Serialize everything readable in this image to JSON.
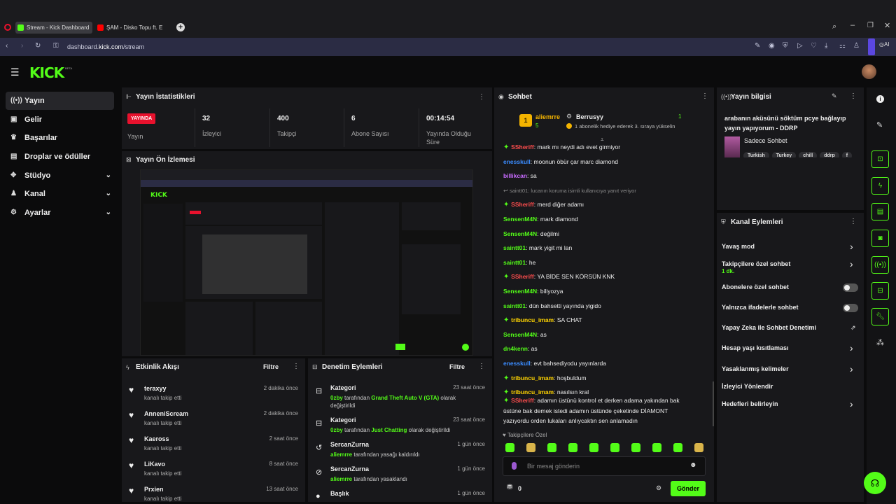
{
  "browser": {
    "tabs": [
      {
        "label": "Stream - Kick Dashboard"
      },
      {
        "label": "ŞAM - Disko Topu ft. E"
      }
    ],
    "url_prefix": "dashboard.",
    "url_host": "kick.com",
    "url_path": "/stream",
    "ai_label": "AI"
  },
  "app": {
    "logo": "KICK",
    "beta": "BETA"
  },
  "sidebar": {
    "items": [
      {
        "label": "Yayın"
      },
      {
        "label": "Gelir"
      },
      {
        "label": "Başarılar"
      },
      {
        "label": "Droplar ve ödüller"
      },
      {
        "label": "Stüdyo"
      },
      {
        "label": "Kanal"
      },
      {
        "label": "Ayarlar"
      }
    ]
  },
  "stats": {
    "title": "Yayın İstatistikleri",
    "live_badge": "YAYINDA",
    "items": [
      {
        "value": "",
        "label": "Yayın"
      },
      {
        "value": "32",
        "label": "İzleyici"
      },
      {
        "value": "400",
        "label": "Takipçi"
      },
      {
        "value": "6",
        "label": "Abone Sayısı"
      },
      {
        "value": "00:14:54",
        "label": "Yayında Olduğu Süre"
      }
    ]
  },
  "preview": {
    "title": "Yayın Ön İzlemesi"
  },
  "activity": {
    "title": "Etkinlik Akışı",
    "filter": "Filtre",
    "items": [
      {
        "name": "teraxyy",
        "sub": "kanalı takip etti",
        "time": "2 dakika önce"
      },
      {
        "name": "AnneniScream",
        "sub": "kanalı takip etti",
        "time": "2 dakika önce"
      },
      {
        "name": "Kaeross",
        "sub": "kanalı takip etti",
        "time": "2 saat önce"
      },
      {
        "name": "LiKavo",
        "sub": "kanalı takip etti",
        "time": "8 saat önce"
      },
      {
        "name": "Prxien",
        "sub": "kanalı takip etti",
        "time": "13 saat önce"
      }
    ]
  },
  "moderation": {
    "title": "Denetim Eylemleri",
    "filter": "Filtre",
    "items": [
      {
        "title": "Kategori",
        "time": "23 saat önce",
        "actor": "0zby",
        "mid": " tarafından ",
        "target": "Grand Theft Auto V (GTA)",
        "rest": " olarak değiştirildi"
      },
      {
        "title": "Kategori",
        "time": "23 saat önce",
        "actor": "0zby",
        "mid": " tarafından ",
        "target": "Just Chatting",
        "rest": " olarak değiştirildi"
      },
      {
        "title": "SercanZurna",
        "time": "1 gün önce",
        "actor": "aliemrre",
        "mid": " tarafından yasağı kaldırıldı",
        "target": "",
        "rest": ""
      },
      {
        "title": "SercanZurna",
        "time": "1 gün önce",
        "actor": "aliemrre",
        "mid": " tarafından yasaklandı",
        "target": "",
        "rest": ""
      },
      {
        "title": "Başlık",
        "time": "1 gün önce",
        "actor": "",
        "mid": "",
        "target": "",
        "rest": ""
      }
    ]
  },
  "chat": {
    "title": "Sohbet",
    "top_gifter": "aliemrre",
    "top_gifter_count": "5",
    "gift_user": "Berrusyy",
    "gift_count": "1",
    "gift_text": "1 abonelik hediye ederek 3. sıraya yükselin",
    "messages": [
      {
        "user": "SSheriff",
        "text": ": mark mı neydi adı evet girmiyor",
        "color": "#ff4d4d",
        "badge": true
      },
      {
        "user": "enesskull",
        "text": ": moonun öbür çar marc diamond",
        "color": "#3b8cff",
        "badge": false
      },
      {
        "user": "billikcan",
        "text": ": sa",
        "color": "#c86bff",
        "badge": false
      },
      {
        "user": "",
        "text": "saintt01: lucanın koruma isimli kullanıcıya yanıt veriyor",
        "color": "#888",
        "badge": false,
        "reply": true
      },
      {
        "user": "SSheriff",
        "text": ": merd diğer adamı",
        "color": "#ff4d4d",
        "badge": true
      },
      {
        "user": "SensenM4N",
        "text": ": mark diamond",
        "color": "#53fc18",
        "badge": false
      },
      {
        "user": "SensenM4N",
        "text": ": değilmi",
        "color": "#53fc18",
        "badge": false
      },
      {
        "user": "saintt01",
        "text": ": mark yigit mi lan",
        "color": "#53fc18",
        "badge": false
      },
      {
        "user": "saintt01",
        "text": ": he",
        "color": "#53fc18",
        "badge": false
      },
      {
        "user": "SSheriff",
        "text": ": YA BİDE SEN KÖRSÜN KNK",
        "color": "#ff4d4d",
        "badge": true
      },
      {
        "user": "SensenM4N",
        "text": ": biliyozya",
        "color": "#53fc18",
        "badge": false
      },
      {
        "user": "saintt01",
        "text": ": dün bahsetti yayında yigido",
        "color": "#53fc18",
        "badge": false
      },
      {
        "user": "tribuncu_imam",
        "text": ": SA CHAT",
        "color": "#ffd400",
        "badge": true
      },
      {
        "user": "SensenM4N",
        "text": ": as",
        "color": "#53fc18",
        "badge": false
      },
      {
        "user": "dn4kenn",
        "text": ": as",
        "color": "#53fc18",
        "badge": false
      },
      {
        "user": "enesskull",
        "text": ": evt bahsediyodu yayınlarda",
        "color": "#3b8cff",
        "badge": false
      },
      {
        "user": "tribuncu_imam",
        "text": ": hoşbuldum",
        "color": "#ffd400",
        "badge": true
      },
      {
        "user": "tribuncu_imam",
        "text": ": nasılsın kral",
        "color": "#ffd400",
        "badge": true
      }
    ],
    "last_user": "SSheriff",
    "last_text": ": adamın üstünü kontrol et derken adama yakından bak",
    "last_line2": "üstüne bak demek istedi adamın üstünde çeketinde DİAMONT",
    "last_line3": "yazıyordu orden lukaları anlıycaktın sen anlamadın",
    "followers_only": "Takipçilere Özel",
    "input_placeholder": "Bir mesaj gönderin",
    "points": "0",
    "send": "Gönder"
  },
  "info": {
    "title": "Yayın bilgisi",
    "stream_title_1": "arabanın aküsünü söktüm pcye bağlayıp",
    "stream_title_2": "yayın yapıyorum - DDRP",
    "category": "Sadece Sohbet",
    "tags": [
      "Turkish",
      "Turkey",
      "chill",
      "ddrp",
      "f"
    ]
  },
  "actions": {
    "title": "Kanal Eylemleri",
    "items": [
      {
        "label": "Yavaş mod",
        "type": "chevron",
        "sub": ""
      },
      {
        "label": "Takipçilere özel sohbet",
        "type": "chevron",
        "sub": "1 dk."
      },
      {
        "label": "Abonelere özel sohbet",
        "type": "toggle",
        "sub": ""
      },
      {
        "label": "Yalnızca ifadelerle sohbet",
        "type": "toggle",
        "sub": ""
      },
      {
        "label": "Yapay Zeka ile Sohbet Denetimi",
        "type": "external",
        "sub": ""
      },
      {
        "label": "Hesap yaşı kısıtlaması",
        "type": "chevron",
        "sub": ""
      },
      {
        "label": "Yasaklanmış kelimeler",
        "type": "chevron",
        "sub": ""
      },
      {
        "label": "İzleyici Yönlendir",
        "type": "none",
        "sub": ""
      },
      {
        "label": "Hedefleri belirleyin",
        "type": "chevron",
        "sub": ""
      }
    ]
  },
  "colors": {
    "brand": "#53fc18",
    "live": "#e8112d",
    "panel": "#18181b"
  }
}
